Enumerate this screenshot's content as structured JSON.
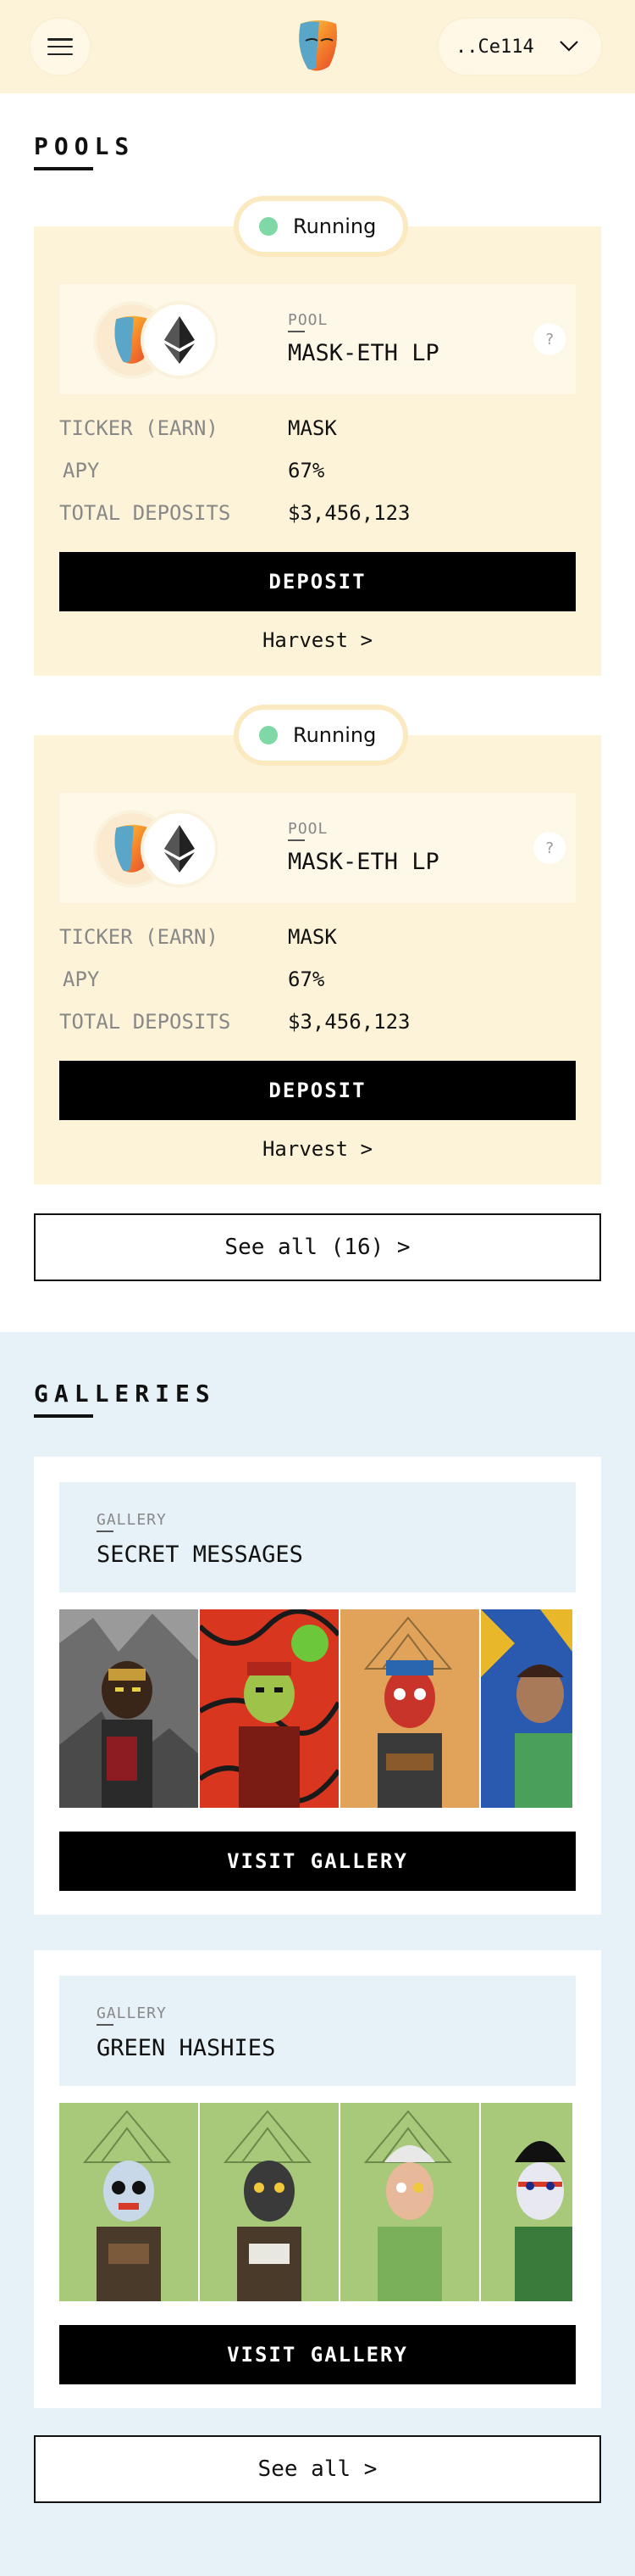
{
  "header": {
    "wallet_address": "..Ce114"
  },
  "pools": {
    "title": "POOLS",
    "items": [
      {
        "status": "Running",
        "pool_label": "POOL",
        "pool_name": "MASK-ETH LP",
        "help": "?",
        "ticker_label": "TICKER (EARN)",
        "ticker_value": "MASK",
        "apy_label": "APY",
        "apy_value": "67%",
        "deposits_label": "TOTAL DEPOSITS",
        "deposits_value": "$3,456,123",
        "deposit_label": "DEPOSIT",
        "harvest_label": "Harvest >"
      },
      {
        "status": "Running",
        "pool_label": "POOL",
        "pool_name": "MASK-ETH LP",
        "help": "?",
        "ticker_label": "TICKER (EARN)",
        "ticker_value": "MASK",
        "apy_label": "APY",
        "apy_value": "67%",
        "deposits_label": "TOTAL DEPOSITS",
        "deposits_value": "$3,456,123",
        "deposit_label": "DEPOSIT",
        "harvest_label": "Harvest >"
      }
    ],
    "see_all_label": "See all (16) >"
  },
  "galleries": {
    "title": "GALLERIES",
    "items": [
      {
        "label": "GALLERY",
        "name": "SECRET MESSAGES",
        "visit_label": "VISIT GALLERY"
      },
      {
        "label": "GALLERY",
        "name": "GREEN HASHIES",
        "visit_label": "VISIT GALLERY"
      }
    ],
    "see_all_label": "See all >"
  },
  "colors": {
    "header_bg": "#fdf3d9",
    "pool_card_bg": "#fdf3d9",
    "gallery_section_bg": "#e6f2f7",
    "status_running": "#7ed9a4",
    "button_bg": "#000000"
  },
  "icons": [
    "hamburger-menu-icon",
    "mask-logo",
    "chevron-down-icon",
    "mask-token-icon",
    "ethereum-icon",
    "help-icon",
    "status-dot"
  ]
}
